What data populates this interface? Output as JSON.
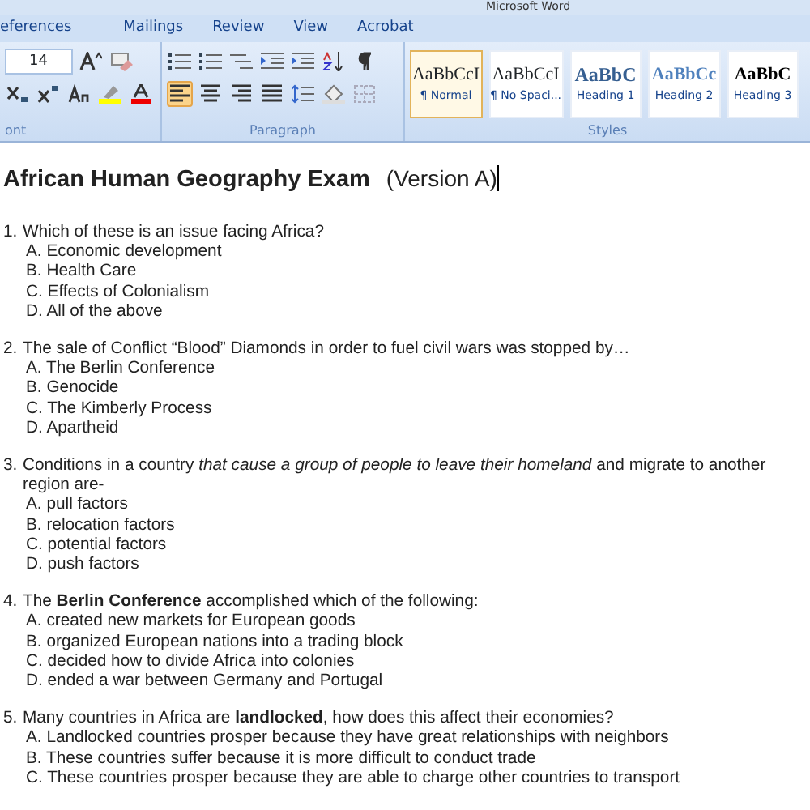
{
  "window": {
    "title": "Microsoft Word"
  },
  "ribbon": {
    "tabs": [
      {
        "label": "eferences"
      },
      {
        "label": "Mailings"
      },
      {
        "label": "Review"
      },
      {
        "label": "View"
      },
      {
        "label": "Acrobat"
      }
    ],
    "font_size": "14",
    "alignment": [
      {
        "kind": "left",
        "selected": true
      },
      {
        "kind": "center",
        "selected": false
      },
      {
        "kind": "right",
        "selected": false
      },
      {
        "kind": "justify",
        "selected": false
      }
    ],
    "groups": [
      "ont",
      "Paragraph",
      "Styles"
    ],
    "styles": [
      {
        "kind": "normal",
        "preview": "AaBbCcI",
        "label": "¶ Normal",
        "selected": true
      },
      {
        "kind": "normal",
        "preview": "AaBbCcI",
        "label": "¶ No Spaci...",
        "selected": false
      },
      {
        "kind": "heading1",
        "preview": "AaBbC",
        "label": "Heading 1",
        "selected": false
      },
      {
        "kind": "heading2",
        "preview": "AaBbCc",
        "label": "Heading 2",
        "selected": false
      },
      {
        "kind": "heading3",
        "preview": "AaBbC",
        "label": "Heading 3",
        "selected": false
      }
    ]
  },
  "document": {
    "title": "African Human Geography Exam",
    "subtitle": "(Version A)",
    "questions": [
      {
        "number": "1.",
        "text": "Which of these is an issue facing Africa?",
        "options": [
          "A. Economic development",
          "B. Health Care",
          "C. Effects of Colonialism",
          "D. All of the above"
        ]
      },
      {
        "number": "2.",
        "text": "The sale of Conflict “Blood” Diamonds in order to fuel civil wars was stopped by…",
        "options": [
          "A. The Berlin Conference",
          "B. Genocide",
          "C. The Kimberly Process",
          "D. Apartheid"
        ]
      },
      {
        "number": "3.",
        "text": "Conditions in a country *that cause a group of people to leave their homeland* and migrate to another region are-",
        "options": [
          "A. pull factors",
          "B. relocation factors",
          "C. potential factors",
          "D. push factors"
        ]
      },
      {
        "number": "4.",
        "text": "The **Berlin Conference** accomplished which of the following:",
        "options": [
          "A.  created new markets for European goods",
          "B.  organized European nations into a trading block",
          "C.  decided how to divide Africa into colonies",
          "D.  ended a war between Germany and Portugal"
        ]
      },
      {
        "number": "5.",
        "text": "Many countries in Africa are **landlocked**, how does this affect their economies?",
        "options": [
          "A. Landlocked countries prosper because they have great relationships with neighbors",
          "B. These countries suffer because it is more difficult to conduct trade",
          "C. These countries prosper because they are able to charge other countries to transport"
        ]
      }
    ]
  }
}
